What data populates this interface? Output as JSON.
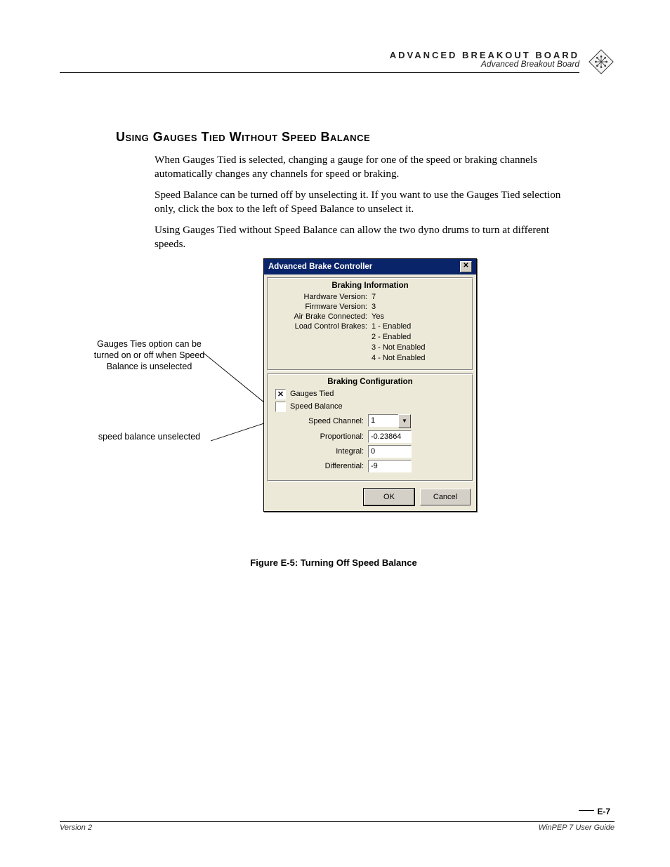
{
  "header": {
    "top": "ADVANCED BREAKOUT BOARD",
    "sub": "Advanced Breakout Board"
  },
  "section_title": "Using Gauges Tied Without Speed Balance",
  "paragraphs": {
    "p1": "When Gauges Tied is selected, changing a gauge for one of the speed or braking channels automatically changes any channels for speed or braking.",
    "p2": "Speed Balance can be turned off by unselecting it. If you want to use the Gauges Tied selection only, click the box to the left of Speed Balance to unselect it.",
    "p3": "Using Gauges Tied without Speed Balance can allow the two dyno drums to turn at different speeds."
  },
  "callouts": {
    "c1": "Gauges Ties option can be turned on or off when Speed Balance is unselected",
    "c2": "speed balance unselected"
  },
  "dialog": {
    "title": "Advanced Brake Controller",
    "info_title": "Braking Information",
    "hardware_label": "Hardware Version:",
    "hardware_value": "7",
    "firmware_label": "Firmware Version:",
    "firmware_value": "3",
    "airbrake_label": "Air Brake Connected:",
    "airbrake_value": "Yes",
    "lcb_label": "Load Control Brakes:",
    "lcb_1": "1 - Enabled",
    "lcb_2": "2 - Enabled",
    "lcb_3": "3 - Not Enabled",
    "lcb_4": "4 - Not Enabled",
    "config_title": "Braking Configuration",
    "gauges_tied": "Gauges Tied",
    "speed_balance": "Speed Balance",
    "speed_channel_label": "Speed Channel:",
    "speed_channel_value": "1",
    "proportional_label": "Proportional:",
    "proportional_value": "-0.23864",
    "integral_label": "Integral:",
    "integral_value": "0",
    "differential_label": "Differential:",
    "differential_value": "-9",
    "ok": "OK",
    "cancel": "Cancel"
  },
  "figure_caption": "Figure E-5: Turning Off Speed Balance",
  "footer": {
    "left": "Version 2",
    "right": "WinPEP 7 User Guide",
    "page": "E-7"
  }
}
